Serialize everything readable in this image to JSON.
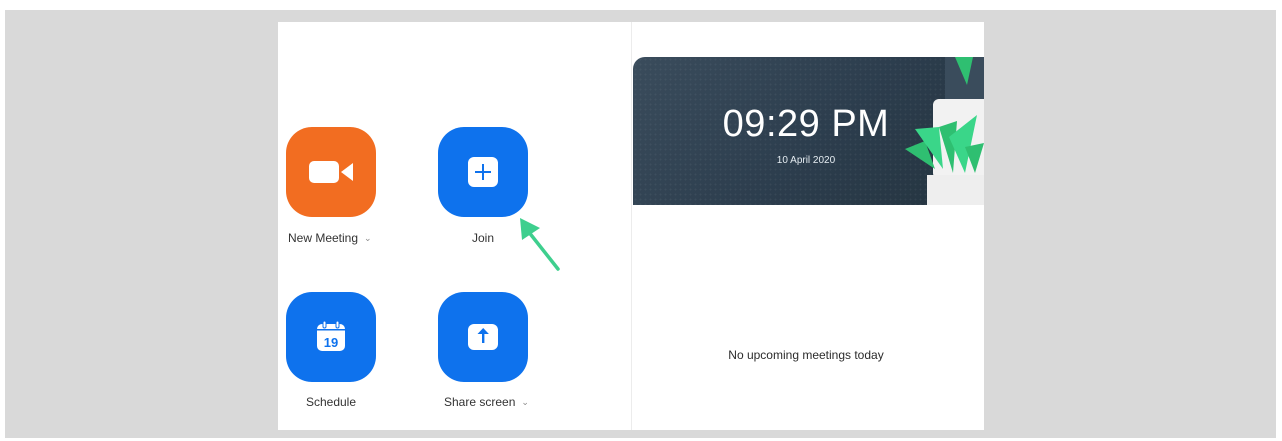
{
  "actions": {
    "new_meeting": {
      "label": "New Meeting",
      "icon": "video-camera-icon",
      "caret": "⌄",
      "color": "#f26d21"
    },
    "join": {
      "label": "Join",
      "icon": "plus-icon",
      "color": "#0e72ed"
    },
    "schedule": {
      "label": "Schedule",
      "icon": "calendar-icon",
      "day": "19",
      "color": "#0e72ed"
    },
    "share_screen": {
      "label": "Share screen",
      "icon": "upload-arrow-icon",
      "caret": "⌄",
      "color": "#0e72ed"
    }
  },
  "header": {
    "time": "09:29 PM",
    "date": "10 April 2020"
  },
  "meetings": {
    "empty_message": "No upcoming meetings today"
  },
  "annotation": {
    "icon": "pointer-arrow-icon",
    "color": "#3ecf8e"
  }
}
